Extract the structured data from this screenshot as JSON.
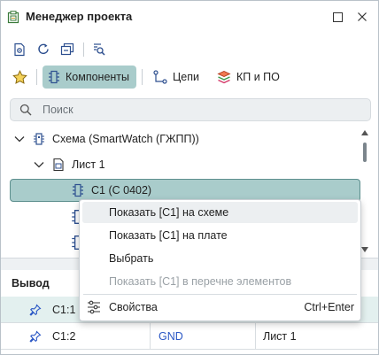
{
  "window": {
    "title": "Менеджер проекта",
    "restore_icon": "restore-icon",
    "close_icon": "close-icon"
  },
  "toolbar": {
    "icons": [
      "view-icon",
      "refresh-icon",
      "collapse-icon",
      "search-settings-icon"
    ]
  },
  "tabs": {
    "favorites_icon": "star-icon",
    "items": [
      {
        "label": "Компоненты",
        "icon": "component-icon",
        "active": true
      },
      {
        "label": "Цепи",
        "icon": "net-icon",
        "active": false
      },
      {
        "label": "КП и ПО",
        "icon": "layers-icon",
        "active": false
      }
    ]
  },
  "search": {
    "placeholder": "Поиск",
    "value": ""
  },
  "tree": {
    "items": [
      {
        "label": "Схема (SmartWatch (ГЖПП))",
        "level": 0,
        "expanded": true,
        "icon": "schematic-icon"
      },
      {
        "label": "Лист 1",
        "level": 1,
        "expanded": true,
        "icon": "sheet-icon"
      },
      {
        "label": "C1 (C 0402)",
        "level": 2,
        "selected": true,
        "icon": "component-icon"
      }
    ]
  },
  "context_menu": {
    "items": [
      {
        "label": "Показать [C1] на схеме",
        "state": "hover"
      },
      {
        "label": "Показать [C1] на плате",
        "state": "normal"
      },
      {
        "label": "Выбрать",
        "state": "normal"
      },
      {
        "label": "Показать [C1] в перечне элементов",
        "state": "disabled"
      },
      {
        "label": "Свойства",
        "shortcut": "Ctrl+Enter",
        "icon": "settings-icon",
        "state": "normal"
      }
    ]
  },
  "pins_table": {
    "columns": [
      "Вывод"
    ],
    "rows": [
      {
        "pin": "C1:1",
        "net": "",
        "sheet": "",
        "selected": true
      },
      {
        "pin": "C1:2",
        "net": "GND",
        "sheet": "Лист 1",
        "selected": false
      }
    ]
  },
  "colors": {
    "accent": "#a9cccb",
    "accent_border": "#5d8f8e",
    "net_link": "#2a57c5",
    "pin_icon": "#2a57c5"
  }
}
